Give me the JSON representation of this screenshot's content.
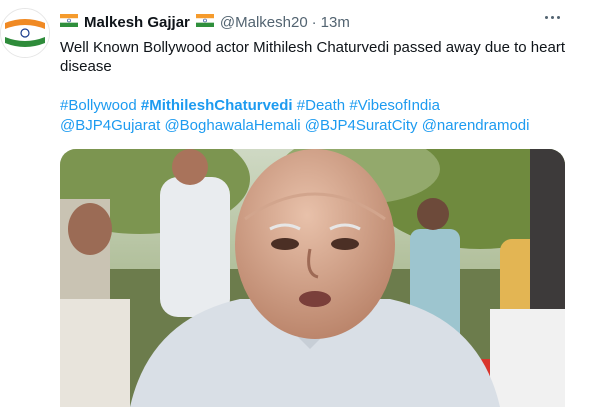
{
  "tweet": {
    "display_name": "Malkesh Gajjar",
    "handle": "@Malkesh20",
    "separator": "·",
    "time": "13m",
    "text": "Well Known Bollywood actor Mithilesh Chaturvedi passed away due to heart disease",
    "hashtags_line1": [
      {
        "text": "#Bollywood",
        "bold": false
      },
      {
        "text": "#MithileshChaturvedi",
        "bold": true
      },
      {
        "text": "#Death",
        "bold": false
      },
      {
        "text": "#VibesofIndia",
        "bold": false
      }
    ],
    "mentions_line2": [
      "@BJP4Gujarat",
      "@BoghawalaHemali",
      "@BJP4SuratCity",
      "@narendramodi"
    ]
  },
  "icons": {
    "flag": "india-flag-icon",
    "more": "more-options-icon"
  },
  "colors": {
    "link": "#1d9bf0",
    "secondary_text": "#536471",
    "primary_text": "#0f1419"
  }
}
